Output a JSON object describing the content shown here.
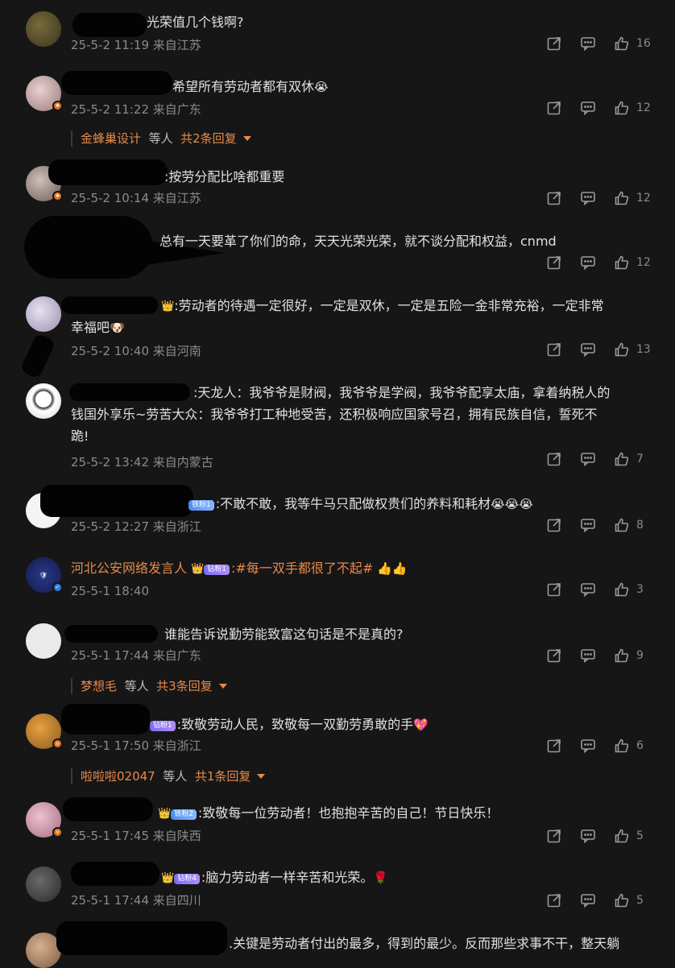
{
  "comments": [
    {
      "text": "光荣值几个钱啊?",
      "meta": "25-5-2 11:19 来自江苏",
      "likes": "16"
    },
    {
      "text": "希望所有劳动者都有双休",
      "meta": "25-5-2 11:22 来自广东",
      "likes": "12",
      "reply": {
        "who": "金蜂巢设计",
        "etc": "等人",
        "count": "共2条回复"
      }
    },
    {
      "text": ":按劳分配比啥都重要",
      "meta": "25-5-2 10:14 来自江苏",
      "likes": "12"
    },
    {
      "text": "总有一天要革了你们的命，天天光荣光荣，就不谈分配和权益，cnmd",
      "meta": "",
      "likes": "12"
    },
    {
      "text": ":劳动者的待遇一定很好，一定是双休，一定是五险一金非常充裕，一定非常",
      "text2": "幸福吧",
      "meta": "25-5-2 10:40 来自河南",
      "likes": "13"
    },
    {
      "text": ":天龙人：我爷爷是财阀，我爷爷是学阀，我爷爷配享太庙，拿着纳税人的",
      "text2": "钱国外享乐~劳苦大众：我爷爷打工种地受苦，还积极响应国家号召，拥有民族自信，誓死不",
      "text3": "跪!",
      "meta": "25-5-2 13:42 来自内蒙古",
      "likes": "7"
    },
    {
      "badge": "铁粉1",
      "text": ":不敢不敢，我等牛马只配做权贵们的养料和耗材",
      "meta": "25-5-2 12:27 来自浙江",
      "likes": "8"
    },
    {
      "name": "河北公安网络发言人",
      "badge": "钻粉1",
      "text": ":#每一双手都很了不起#",
      "meta": "25-5-1 18:40",
      "likes": "3",
      "avatar_label": "河北公安"
    },
    {
      "text": "谁能告诉说勤劳能致富这句话是不是真的?",
      "meta": "25-5-1 17:44 来自广东",
      "likes": "9",
      "reply": {
        "who": "梦想毛",
        "etc": "等人",
        "count": "共3条回复"
      }
    },
    {
      "badge": "钻粉1",
      "text": ":致敬劳动人民，致敬每一双勤劳勇敢的手",
      "meta": "25-5-1 17:50 来自浙江",
      "likes": "6",
      "reply": {
        "who": "啦啦啦02047",
        "etc": "等人",
        "count": "共1条回复"
      }
    },
    {
      "badge": "铁粉2",
      "text": ":致敬每一位劳动者！也抱抱辛苦的自己！节日快乐！",
      "meta": "25-5-1 17:45 来自陕西",
      "likes": "5"
    },
    {
      "badge": "钻粉4",
      "text": ":脑力劳动者一样辛苦和光荣。",
      "meta": "25-5-1 17:44 来自四川",
      "likes": "5"
    },
    {
      "text": ".关键是劳动者付出的最多，得到的最少。反而那些求事不干，整天躺",
      "meta": "",
      "likes": ""
    }
  ],
  "icons": {
    "share": "share-icon",
    "comment": "comment-icon",
    "like": "like-icon"
  },
  "colors": {
    "background": "#161616",
    "accent": "#e8894a",
    "meta": "#8a8a8a"
  }
}
